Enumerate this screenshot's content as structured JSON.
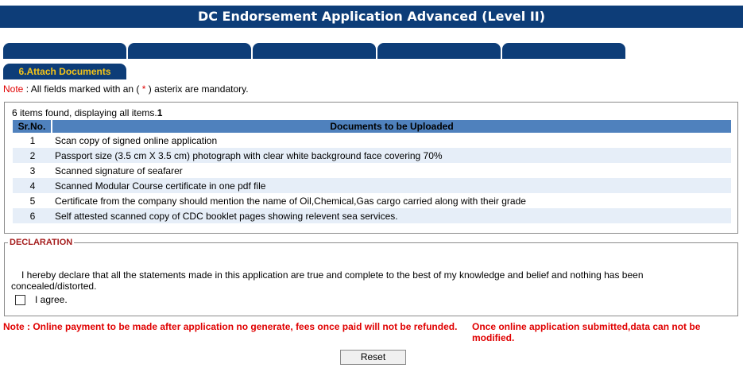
{
  "header": {
    "title": "DC Endorsement Application Advanced (Level II)"
  },
  "tabs": {
    "count_blank": 5,
    "active_label": "6.Attach Documents"
  },
  "note": {
    "prefix": "Note",
    "text_before": " : All fields marked with an ( ",
    "asterisk": "*",
    "text_after": " ) asterix are mandatory."
  },
  "documents": {
    "items_found_text": "6 items found, displaying all items.",
    "page_number": "1",
    "columns": {
      "sr_no": "Sr.No.",
      "document": "Documents to be Uploaded"
    },
    "rows": [
      {
        "sr": "1",
        "doc": "Scan copy of signed online application"
      },
      {
        "sr": "2",
        "doc": "Passport size (3.5 cm X 3.5 cm) photograph with clear white background face covering 70%"
      },
      {
        "sr": "3",
        "doc": "Scanned signature of seafarer"
      },
      {
        "sr": "4",
        "doc": "Scanned Modular Course certificate in one pdf file"
      },
      {
        "sr": "5",
        "doc": "Certificate from the company should mention the name of Oil,Chemical,Gas cargo carried along with their grade"
      },
      {
        "sr": "6",
        "doc": "Self attested scanned copy of CDC booklet pages showing relevent sea services."
      }
    ]
  },
  "declaration": {
    "legend": "DECLARATION",
    "text": "I hereby declare that all the statements made in this application are true and complete to the best of my knowledge and belief and nothing has been concealed/distorted.",
    "agree_label": "I agree."
  },
  "footer_notes": {
    "left": "Note : Online payment to be made after application no generate, fees once paid will not be refunded.",
    "right": "Once online application submitted,data can not be modified."
  },
  "buttons": {
    "reset": "Reset"
  },
  "colors": {
    "primary": "#0d3d78",
    "header_blue": "#4f81bd",
    "alt_row": "#e6eef8",
    "note_red": "#e00000",
    "active_tab_text": "#f5c518"
  }
}
